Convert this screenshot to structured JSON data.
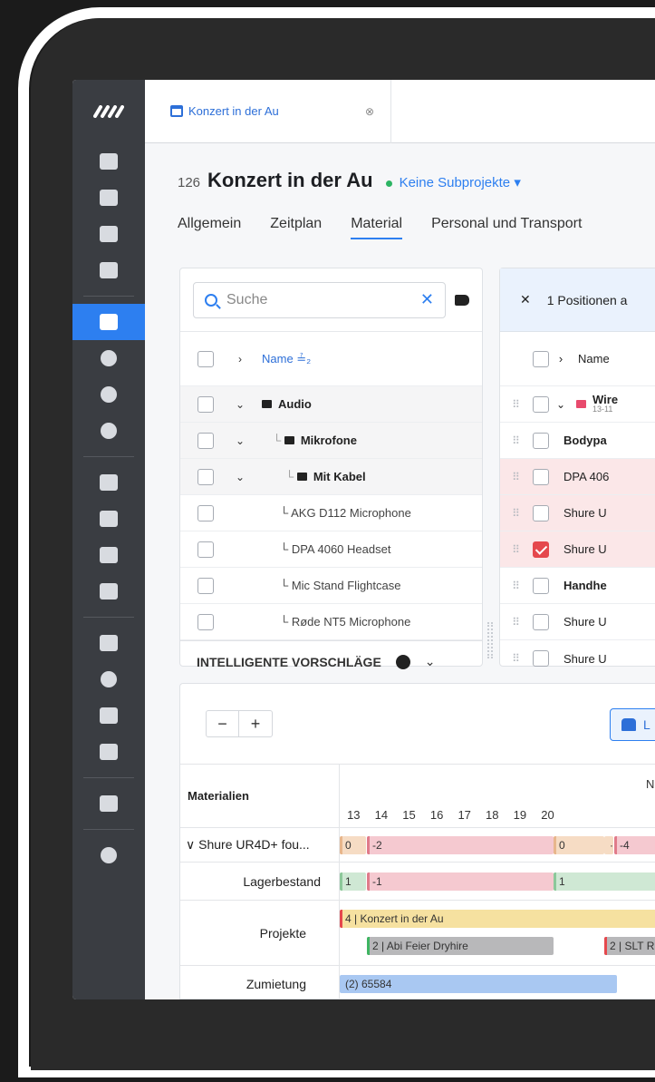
{
  "tab": {
    "title": "Konzert in der Au",
    "close": "⊗"
  },
  "header": {
    "number": "126",
    "title": "Konzert in der Au",
    "subprojects": "Keine Subprojekte ▾"
  },
  "nav": [
    "Allgemein",
    "Zeitplan",
    "Material",
    "Personal und Transport"
  ],
  "left": {
    "search_placeholder": "Suche",
    "clear": "✕",
    "header_name": "Name ≟₂",
    "chevron_right": "›",
    "rows": [
      {
        "label": "Audio",
        "prefix": "",
        "chev": "⌄"
      },
      {
        "label": "Mikrofone",
        "prefix": "└ ",
        "chev": "⌄"
      },
      {
        "label": "Mit Kabel",
        "prefix": "└ ",
        "chev": "⌄"
      }
    ],
    "items": [
      "└ AKG D112 Microphone",
      "└ DPA 4060 Headset",
      "└ Mic Stand Flightcase",
      "└ Røde NT5 Microphone"
    ],
    "footer": "INTELLIGENTE VORSCHLÄGE",
    "footer_chev": "⌄"
  },
  "right": {
    "close": "✕",
    "selection": "1 Positionen a",
    "header_name": "Name",
    "chevron_right": "›",
    "group": {
      "label": "Wire",
      "sub": "13-11"
    },
    "rows": [
      "Bodypa",
      "DPA 406",
      "Shure U",
      "Shure U",
      "Handhe",
      "Shure U",
      "Shure U"
    ],
    "drag": "⠿"
  },
  "timeline": {
    "minus": "−",
    "plus": "+",
    "lager": "L",
    "month_letter": "N",
    "col_header": "Materialien",
    "days": [
      "13",
      "14",
      "15",
      "16",
      "17",
      "18",
      "19",
      "20"
    ],
    "rows": {
      "item": "∨ Shure UR4D+ fou...",
      "lager": "Lagerbestand",
      "projekte": "Projekte",
      "zumietung": "Zumietung"
    },
    "bars": {
      "item_a": "0",
      "item_b": "-2",
      "item_c": "0",
      "item_d": "·",
      "item_e": "-4",
      "lager_a": "1",
      "lager_b": "-1",
      "lager_c": "1",
      "proj_a": "4 | Konzert in der Au",
      "proj_b": "2 | Abi Feier Dryhire",
      "proj_c": "2 | SLT R",
      "zum_a": "(2) 65584"
    }
  }
}
